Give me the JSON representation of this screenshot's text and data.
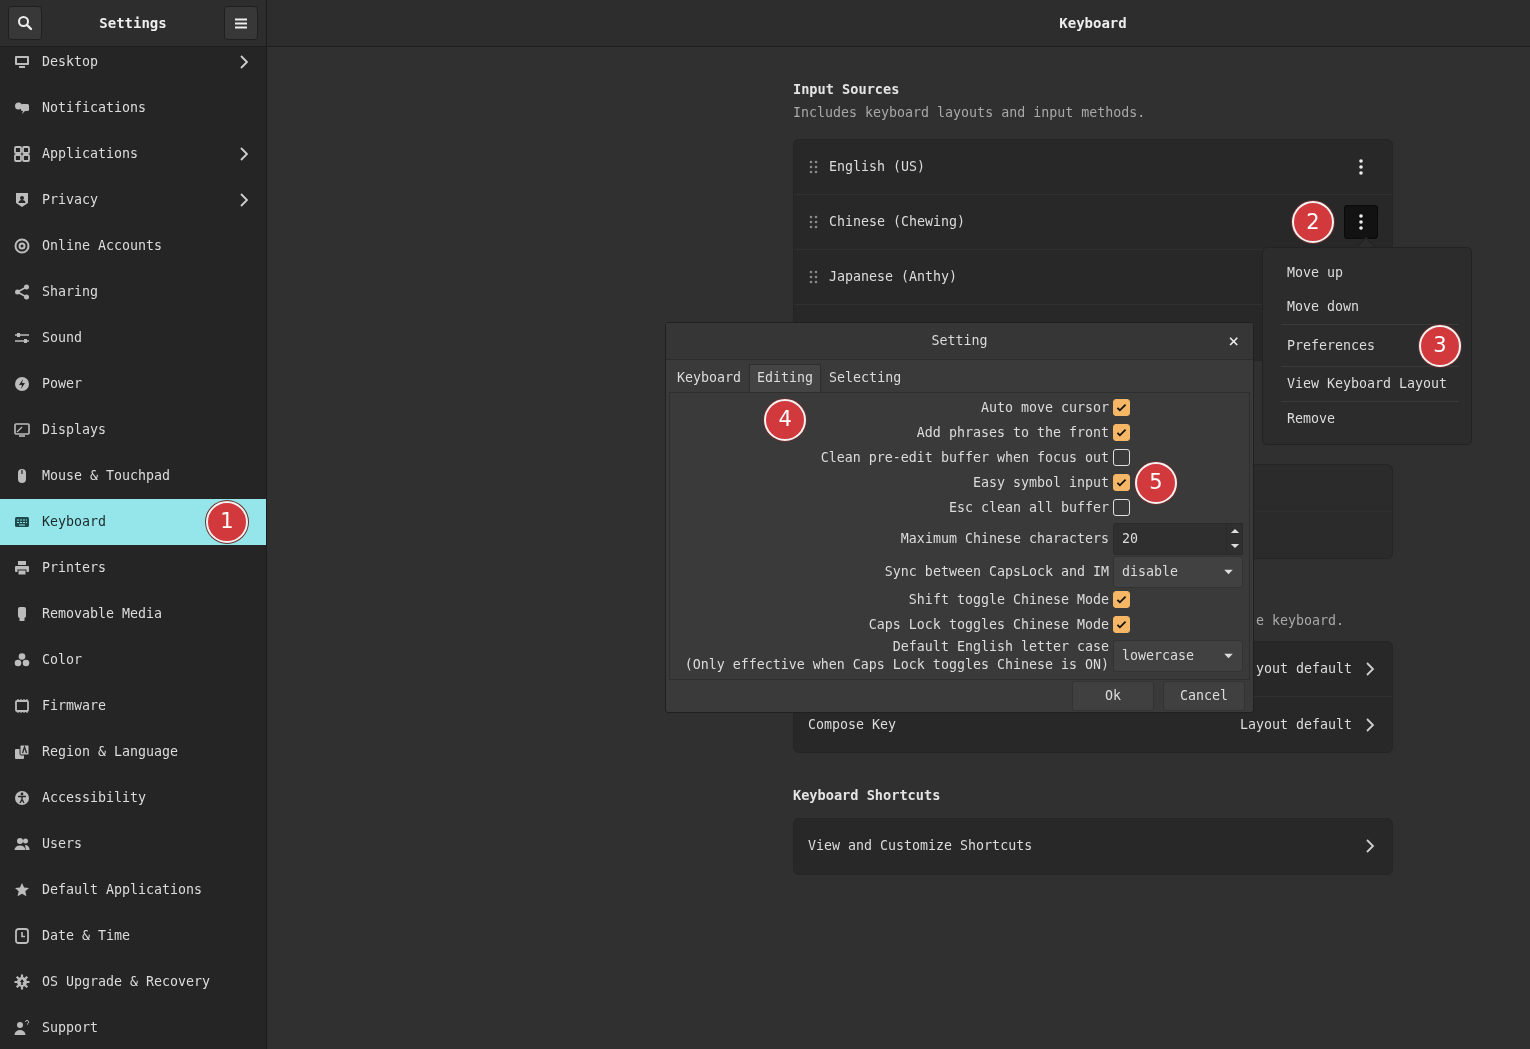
{
  "header": {
    "title": "Settings",
    "page_title": "Keyboard"
  },
  "sidebar": {
    "items": [
      {
        "label": "Desktop",
        "selected": false,
        "submenu": true
      },
      {
        "label": "Notifications",
        "selected": false,
        "submenu": false
      },
      {
        "label": "Applications",
        "selected": false,
        "submenu": true
      },
      {
        "label": "Privacy",
        "selected": false,
        "submenu": true
      },
      {
        "label": "Online Accounts",
        "selected": false,
        "submenu": false
      },
      {
        "label": "Sharing",
        "selected": false,
        "submenu": false
      },
      {
        "label": "Sound",
        "selected": false,
        "submenu": false
      },
      {
        "label": "Power",
        "selected": false,
        "submenu": false
      },
      {
        "label": "Displays",
        "selected": false,
        "submenu": false
      },
      {
        "label": "Mouse & Touchpad",
        "selected": false,
        "submenu": false
      },
      {
        "label": "Keyboard",
        "selected": true,
        "submenu": false,
        "annotation": "1"
      },
      {
        "label": "Printers",
        "selected": false,
        "submenu": false
      },
      {
        "label": "Removable Media",
        "selected": false,
        "submenu": false
      },
      {
        "label": "Color",
        "selected": false,
        "submenu": false
      },
      {
        "label": "Firmware",
        "selected": false,
        "submenu": false
      },
      {
        "label": "Region & Language",
        "selected": false,
        "submenu": false
      },
      {
        "label": "Accessibility",
        "selected": false,
        "submenu": false
      },
      {
        "label": "Users",
        "selected": false,
        "submenu": false
      },
      {
        "label": "Default Applications",
        "selected": false,
        "submenu": false
      },
      {
        "label": "Date & Time",
        "selected": false,
        "submenu": false
      },
      {
        "label": "OS Upgrade & Recovery",
        "selected": false,
        "submenu": false
      },
      {
        "label": "Support",
        "selected": false,
        "submenu": false
      }
    ]
  },
  "input_sources": {
    "title": "Input Sources",
    "description": "Includes keyboard layouts and input methods.",
    "items": [
      {
        "label": "English (US)",
        "pressed": false
      },
      {
        "label": "Chinese (Chewing)",
        "pressed": true,
        "annotation": "2"
      },
      {
        "label": "Japanese (Anthy)"
      }
    ]
  },
  "layout_section": {
    "description": "e keyboard.",
    "rows": [
      {
        "value": "yout default"
      },
      {
        "label": "Compose Key",
        "value": "Layout default"
      }
    ]
  },
  "shortcuts": {
    "title": "Keyboard Shortcuts",
    "rows": [
      {
        "label": "View and Customize Shortcuts"
      }
    ]
  },
  "context_menu": {
    "items": [
      {
        "label": "Move up",
        "divider_above": false
      },
      {
        "label": "Move down",
        "divider_above": false
      },
      {
        "label": "Preferences",
        "divider_above": true,
        "annotation": "3"
      },
      {
        "label": "View Keyboard Layout",
        "divider_above": true
      },
      {
        "label": "Remove",
        "divider_above": true
      }
    ]
  },
  "dialog": {
    "title": "Setting",
    "close": "×",
    "tabs": [
      {
        "label": "Keyboard",
        "selected": false
      },
      {
        "label": "Editing",
        "selected": true,
        "annotation": "4"
      },
      {
        "label": "Selecting",
        "selected": false
      }
    ],
    "rows": [
      {
        "kind": "checkbox",
        "label": "Auto move cursor",
        "checked": true
      },
      {
        "kind": "checkbox",
        "label": "Add phrases to the front",
        "checked": true
      },
      {
        "kind": "checkbox",
        "label": "Clean pre-edit buffer when focus out",
        "checked": false
      },
      {
        "kind": "checkbox",
        "label": "Easy symbol input",
        "checked": true,
        "annotation": "5"
      },
      {
        "kind": "checkbox",
        "label": "Esc clean all buffer",
        "checked": false
      },
      {
        "kind": "spin",
        "label": "Maximum Chinese characters",
        "value": "20"
      },
      {
        "kind": "combo",
        "label": "Sync between CapsLock and IM",
        "value": "disable"
      },
      {
        "kind": "checkbox",
        "label": "Shift toggle Chinese Mode",
        "checked": true
      },
      {
        "kind": "checkbox",
        "label": "Caps Lock toggles Chinese Mode",
        "checked": true
      },
      {
        "kind": "combo",
        "label": "Default English letter case",
        "note": "(Only effective when Caps Lock toggles Chinese is ON)",
        "value": "lowercase"
      }
    ],
    "buttons": [
      "Ok",
      "Cancel"
    ]
  }
}
